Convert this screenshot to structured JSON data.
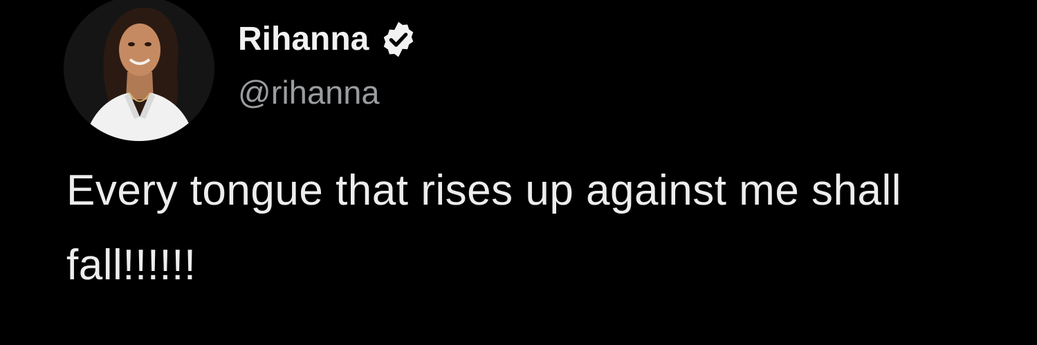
{
  "tweet": {
    "display_name": "Rihanna",
    "handle": "@rihanna",
    "verified_icon": "verified-badge-icon",
    "text": "Every tongue that rises up against me shall fall!!!!!!"
  },
  "colors": {
    "background": "#000000",
    "name": "#f2f2f2",
    "handle": "#9a9da0",
    "text": "#ededed"
  }
}
